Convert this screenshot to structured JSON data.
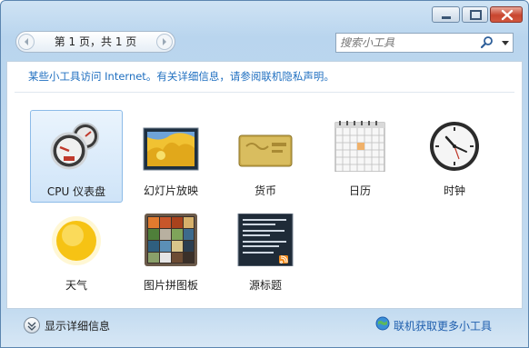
{
  "window": {
    "controls": {
      "minimize_icon": "minimize-icon",
      "maximize_icon": "maximize-icon",
      "close_icon": "close-icon"
    }
  },
  "toolbar": {
    "pager_label": "第 1 页，共 1 页",
    "search_placeholder": "搜索小工具"
  },
  "notice": "某些小工具访问 Internet。有关详细信息，请参阅联机隐私声明。",
  "gadgets": [
    {
      "label": "CPU 仪表盘",
      "icon": "cpu-meter-icon",
      "selected": true
    },
    {
      "label": "幻灯片放映",
      "icon": "slideshow-icon",
      "selected": false
    },
    {
      "label": "货币",
      "icon": "currency-icon",
      "selected": false
    },
    {
      "label": "日历",
      "icon": "calendar-icon",
      "selected": false
    },
    {
      "label": "时钟",
      "icon": "clock-icon",
      "selected": false
    },
    {
      "label": "天气",
      "icon": "weather-icon",
      "selected": false
    },
    {
      "label": "图片拼图板",
      "icon": "picture-puzzle-icon",
      "selected": false
    },
    {
      "label": "源标题",
      "icon": "feed-headlines-icon",
      "selected": false
    }
  ],
  "footer": {
    "details_label": "显示详细信息",
    "online_label": "联机获取更多小工具"
  },
  "colors": {
    "accent_link": "#1f6fc0",
    "selection": "#cfe4f8",
    "close_button": "#c8452f"
  }
}
